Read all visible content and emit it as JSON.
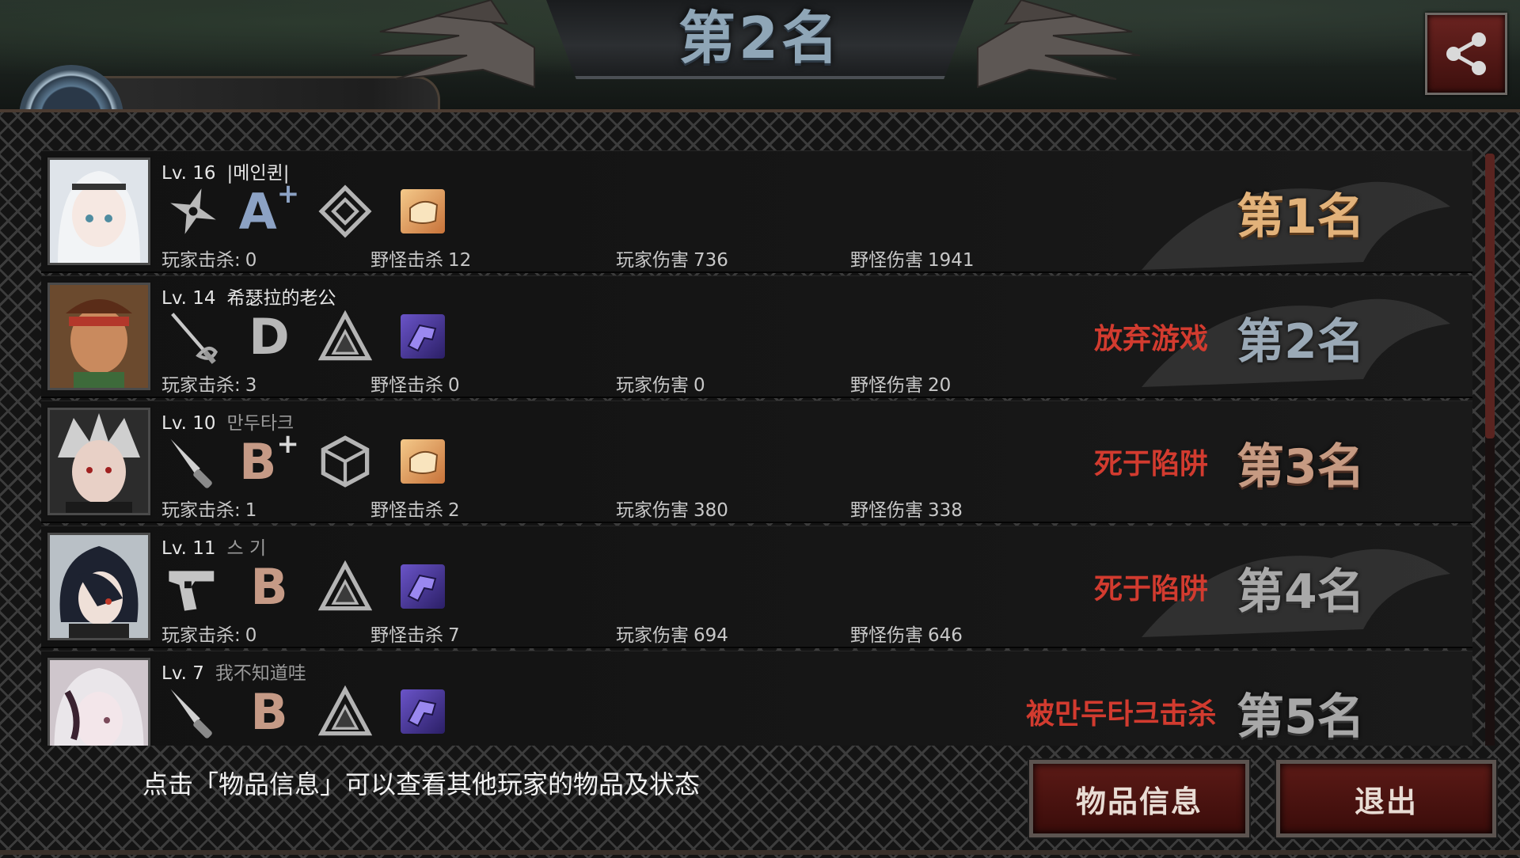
{
  "header": {
    "title": "第2名",
    "badge_text": "",
    "name_plate_text": ""
  },
  "players": [
    {
      "level": "Lv. 16",
      "nickname": "|메인퀸|",
      "grade": "A",
      "grade_suffix": "+",
      "weapon_icon": "shuriken-icon",
      "item_icon": "food-item-icon",
      "player_kills_label": "玩家击杀:",
      "player_kills": "0",
      "monster_kills_label": "野怪击杀",
      "monster_kills": "12",
      "player_damage_label": "玩家伤害",
      "player_damage": "736",
      "monster_damage_label": "野怪伤害",
      "monster_damage": "1941",
      "status": "",
      "rank": "第1名"
    },
    {
      "level": "Lv. 14",
      "nickname": "希瑟拉的老公",
      "grade": "D",
      "grade_suffix": "",
      "weapon_icon": "rapier-icon",
      "item_icon": "purple-item-icon",
      "player_kills_label": "玩家击杀:",
      "player_kills": "3",
      "monster_kills_label": "野怪击杀",
      "monster_kills": "0",
      "player_damage_label": "玩家伤害",
      "player_damage": "0",
      "monster_damage_label": "野怪伤害",
      "monster_damage": "20",
      "status": "放弃游戏",
      "rank": "第2名"
    },
    {
      "level": "Lv. 10",
      "nickname": "만두타크",
      "grade": "B",
      "grade_suffix": "+",
      "weapon_icon": "knife-icon",
      "item_icon": "food-item-icon",
      "player_kills_label": "玩家击杀:",
      "player_kills": "1",
      "monster_kills_label": "野怪击杀",
      "monster_kills": "2",
      "player_damage_label": "玩家伤害",
      "player_damage": "380",
      "monster_damage_label": "野怪伤害",
      "monster_damage": "338",
      "status": "死于陷阱",
      "rank": "第3名"
    },
    {
      "level": "Lv. 11",
      "nickname": "스 기",
      "grade": "B",
      "grade_suffix": "",
      "weapon_icon": "pistol-icon",
      "item_icon": "purple-item-icon",
      "player_kills_label": "玩家击杀:",
      "player_kills": "0",
      "monster_kills_label": "野怪击杀",
      "monster_kills": "7",
      "player_damage_label": "玩家伤害",
      "player_damage": "694",
      "monster_damage_label": "野怪伤害",
      "monster_damage": "646",
      "status": "死于陷阱",
      "rank": "第4名"
    },
    {
      "level": "Lv. 7",
      "nickname": "我不知道哇",
      "grade": "B",
      "grade_suffix": "",
      "weapon_icon": "knife-icon",
      "item_icon": "purple-item-icon",
      "status": "被만두타크击杀",
      "rank": "第5名"
    }
  ],
  "footer": {
    "hint": "点击「物品信息」可以查看其他玩家的物品及状态",
    "item_info_label": "物品信息",
    "exit_label": "退出"
  },
  "colors": {
    "status_red": "#d23b2f",
    "rank_gold": "#e2b27a",
    "rank_silver": "#9aa9b6",
    "rank_bronze": "#c69a82",
    "button_red": "#5b1a16"
  }
}
